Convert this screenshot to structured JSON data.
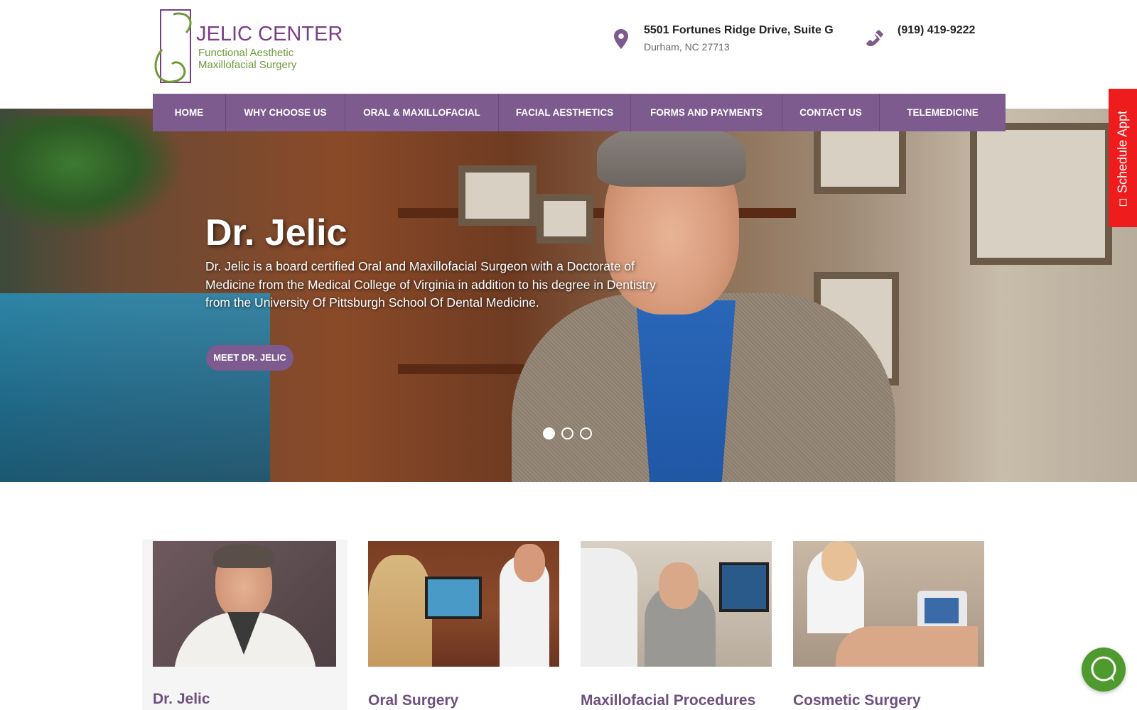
{
  "header": {
    "logo": {
      "name": "JELIC CENTER",
      "tagline_1": "Functional Aesthetic",
      "tagline_2": "Maxillofacial Surgery"
    },
    "address": {
      "line1": "5501 Fortunes Ridge Drive, Suite G",
      "line2": "Durham, NC 27713",
      "icon": "map-pin-icon"
    },
    "phone": {
      "number": "(919) 419-9222",
      "icon": "phone-icon"
    }
  },
  "nav": {
    "items": [
      {
        "label": "HOME"
      },
      {
        "label": "WHY CHOOSE US"
      },
      {
        "label": "ORAL & MAXILLOFACIAL"
      },
      {
        "label": "FACIAL AESTHETICS"
      },
      {
        "label": "FORMS AND PAYMENTS"
      },
      {
        "label": "CONTACT US"
      },
      {
        "label": "TELEMEDICINE"
      }
    ]
  },
  "hero": {
    "title": "Dr. Jelic",
    "description": "Dr. Jelic is a board certified Oral and Maxillofacial Surgeon with a Doctorate of Medicine from the Medical College of Virginia in addition to his degree in Dentistry from the University Of Pittsburgh School Of Dental Medicine.",
    "button": "MEET DR. JELIC",
    "slides": 3,
    "active_slide": 1
  },
  "schedule_tab": {
    "label": "Schedule Appt"
  },
  "cards": [
    {
      "title": "Dr. Jelic"
    },
    {
      "title": "Oral Surgery"
    },
    {
      "title": "Maxillofacial Procedures"
    },
    {
      "title": "Cosmetic Surgery"
    }
  ],
  "colors": {
    "brand_purple": "#7e5b8e",
    "brand_green": "#6e9a3a",
    "schedule_red": "#ee1c1c",
    "chat_green": "#4e9a2e"
  }
}
